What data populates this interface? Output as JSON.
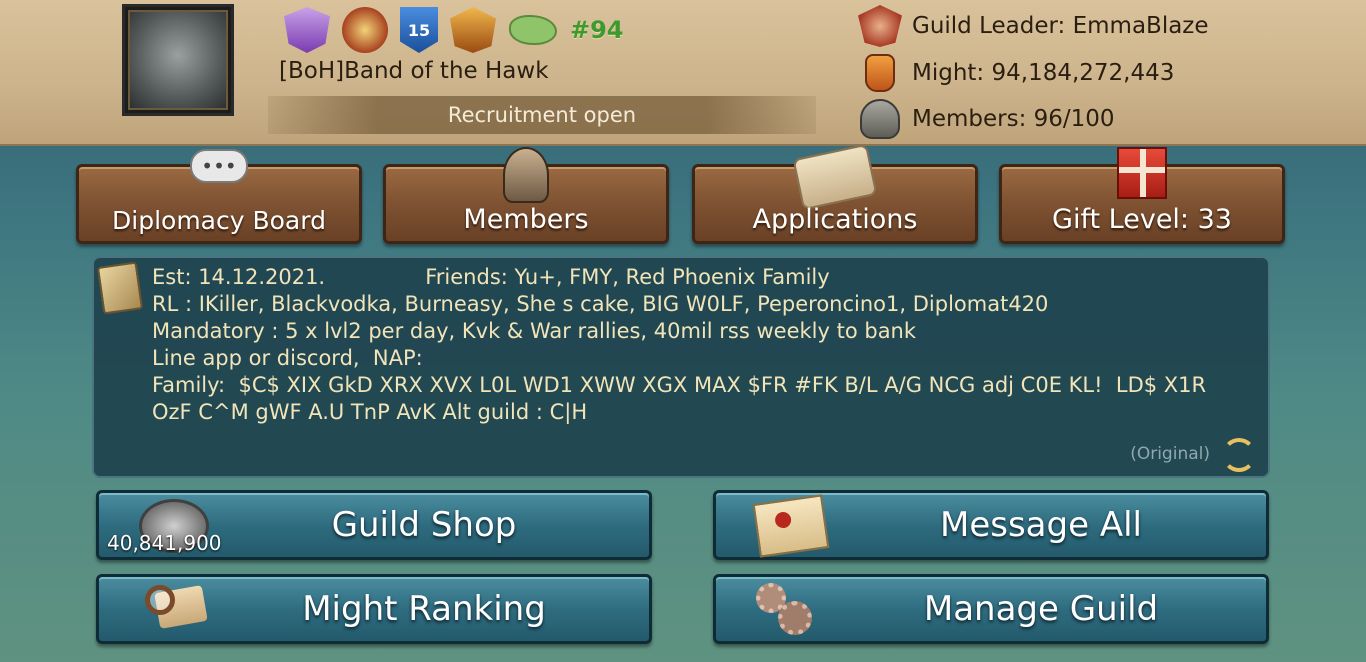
{
  "header": {
    "rank": "#94",
    "badge_level": "15",
    "guild_name": "[BoH]Band of the Hawk",
    "recruitment": "Recruitment open",
    "leader": "Guild Leader: EmmaBlaze",
    "might": "Might: 94,184,272,443",
    "members": "Members: 96/100"
  },
  "nav": {
    "diplomacy": "Diplomacy Board",
    "members": "Members",
    "applications": "Applications",
    "gift": "Gift Level: 33"
  },
  "description": {
    "text": "Est: 14.12.2021.               Friends: Yu+, FMY, Red Phoenix Family\nRL : IKiller, Blackvodka, Burneasy, She s cake, BIG W0LF, Peperoncino1, Diplomat420\nMandatory : 5 x lvl2 per day, Kvk & War rallies, 40mil rss weekly to bank\nLine app or discord,  NAP:\nFamily:  $C$ XIX GkD XRX XVX L0L WD1 XWW XGX MAX $FR #FK B/L A/G NCG adj C0E KL!  LD$ X1R\nOzF C^M gWF A.U TnP AvK Alt guild : C|H",
    "original_label": "(Original)"
  },
  "actions": {
    "guild_shop": "Guild Shop",
    "coins": "40,841,900",
    "message_all": "Message All",
    "might_ranking": "Might Ranking",
    "manage_guild": "Manage Guild"
  },
  "icons": {
    "emblem": "guild-emblem-icon",
    "leader": "shield-sword-icon",
    "might": "fist-icon",
    "members": "helmets-icon",
    "diplomacy": "speech-bubble-icon",
    "members_nav": "spartan-helmet-icon",
    "applications": "scroll-icon",
    "gift": "gift-box-icon",
    "quill": "quill-icon",
    "refresh": "refresh-icon",
    "shop": "guild-coin-icon",
    "message": "envelope-icon",
    "ranking": "magnifier-icon",
    "manage": "gears-icon"
  }
}
